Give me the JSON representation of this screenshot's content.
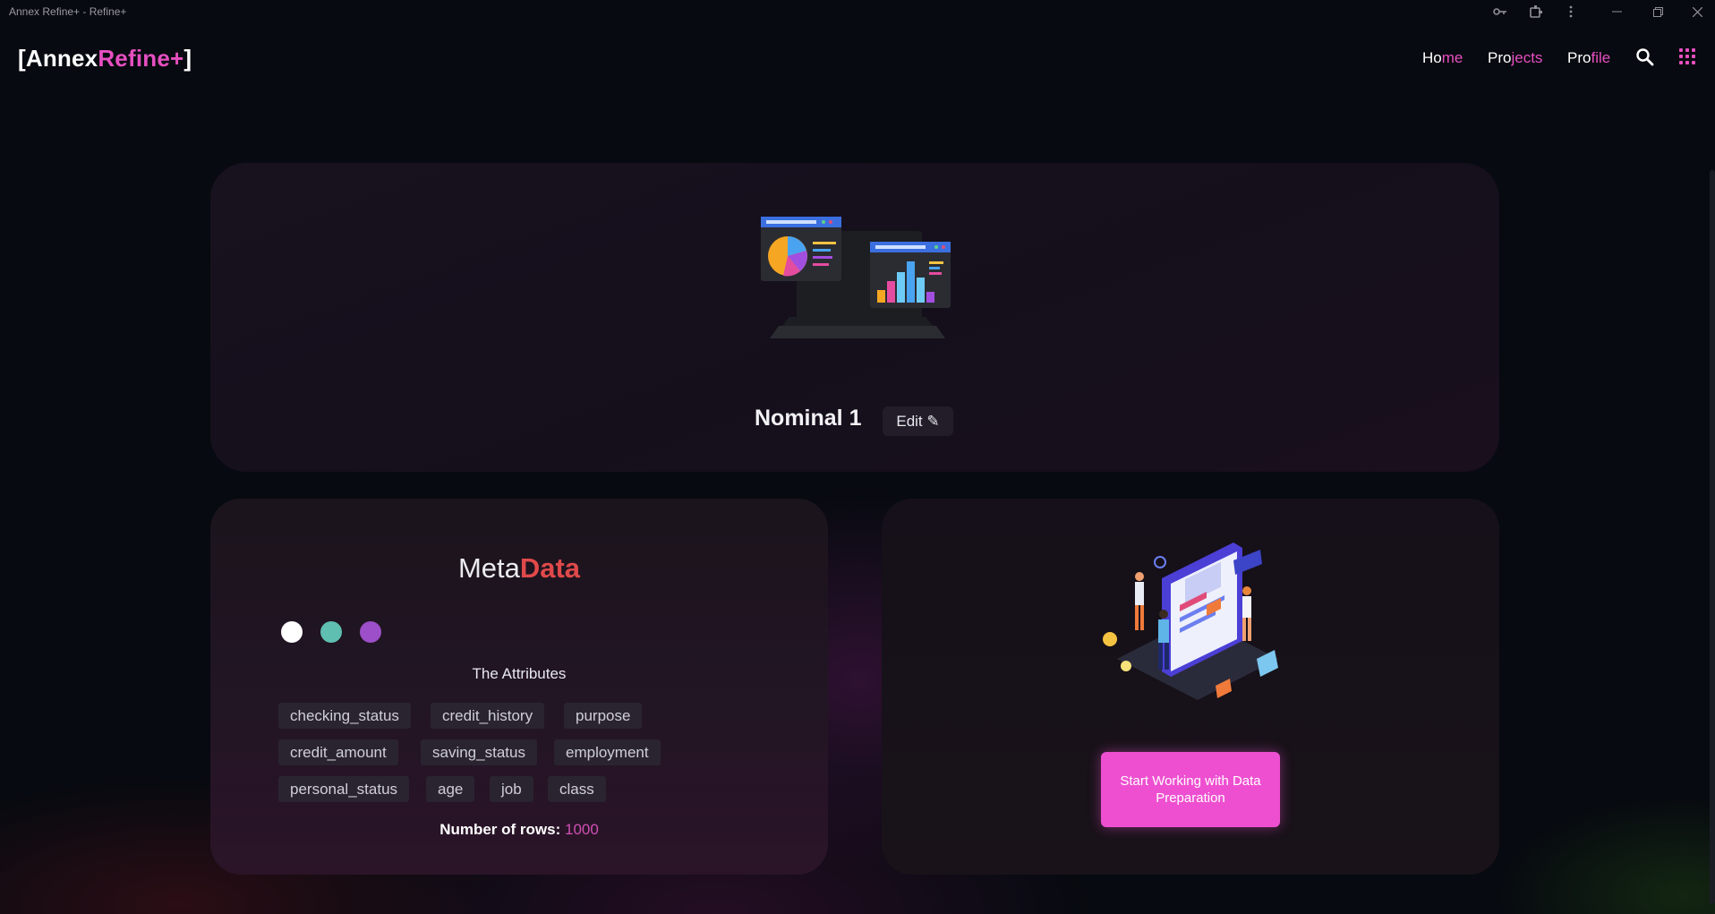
{
  "window": {
    "title": "Annex Refine+ - Refine+"
  },
  "logo": {
    "part1": "[Annex",
    "part2": "Refine+",
    "part3": "]"
  },
  "nav": {
    "home": [
      "Ho",
      "me"
    ],
    "projects": [
      "Pro",
      "jects"
    ],
    "profile": [
      "Pro",
      "file"
    ]
  },
  "project": {
    "title": "Nominal 1",
    "edit_label": "Edit ✎"
  },
  "metadata": {
    "title_part1": "Meta",
    "title_part2": "Data",
    "colors": [
      "#ffffff",
      "#5fbfb0",
      "#9c4fc8"
    ],
    "attributes_title": "The Attributes",
    "attributes": [
      [
        "checking_status",
        "credit_history",
        "purpose"
      ],
      [
        "credit_amount",
        "saving_status",
        "employment"
      ],
      [
        "personal_status",
        "age",
        "job",
        "class"
      ]
    ],
    "rows_label": "Number of rows:",
    "rows_value": "1000"
  },
  "prep": {
    "button_label": "Start Working with Data Preparation"
  },
  "colors": {
    "accent": "#e64fc0",
    "button": "#ee4fd0",
    "data_red": "#e0494a",
    "background": "#070a10"
  }
}
